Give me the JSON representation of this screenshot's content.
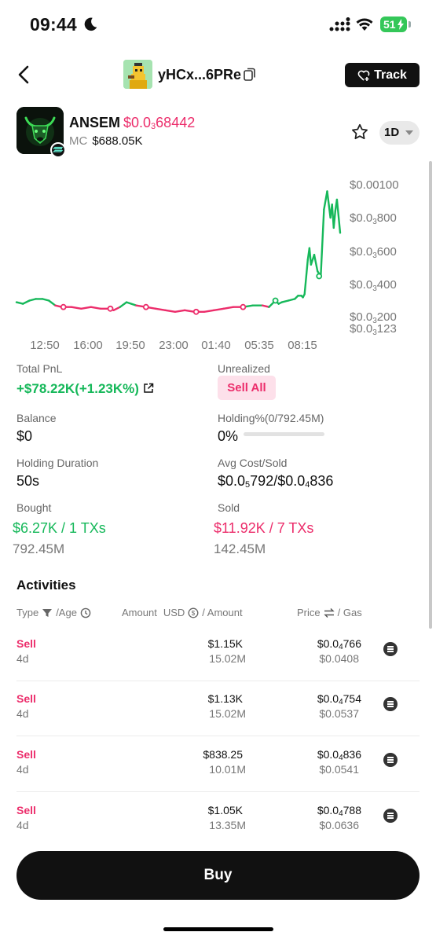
{
  "status": {
    "time": "09:44",
    "battery": "51"
  },
  "header": {
    "wallet_name": "yHCx...6PRe",
    "track_label": "Track"
  },
  "token": {
    "name": "ANSEM",
    "price_prefix": "$0.0",
    "price_sub": "3",
    "price_rest": "68442",
    "mc_label": "MC",
    "mc_value": "$688.05K",
    "timeframe": "1D"
  },
  "icons": {
    "back": "chevron-left-icon",
    "copy": "copy-icon",
    "track": "heart-plus-icon",
    "star": "star-icon",
    "external": "external-link-icon",
    "filter": "filter-icon",
    "clock": "clock-icon",
    "coin": "dollar-coin-icon",
    "swap": "swap-icon",
    "detail": "list-icon"
  },
  "colors": {
    "up": "#16b85a",
    "down": "#ec2d6b",
    "accent_bg": "#111111"
  },
  "chart_data": {
    "type": "line",
    "x_ticks": [
      "12:50",
      "16:00",
      "19:50",
      "23:00",
      "01:40",
      "05:35",
      "08:15"
    ],
    "y_ticks": [
      {
        "prefix": "$0.00100",
        "sub": "",
        "rest": "",
        "value": 0.001
      },
      {
        "prefix": "$0.0",
        "sub": "3",
        "rest": "800",
        "value": 0.0008
      },
      {
        "prefix": "$0.0",
        "sub": "3",
        "rest": "600",
        "value": 0.0006
      },
      {
        "prefix": "$0.0",
        "sub": "3",
        "rest": "400",
        "value": 0.0004
      },
      {
        "prefix": "$0.0",
        "sub": "3",
        "rest": "200",
        "value": 0.0002
      },
      {
        "prefix": "$0.0",
        "sub": "3",
        "rest": "123",
        "value": 0.000123
      }
    ],
    "ylim": [
      0.000123,
      0.001
    ],
    "series": [
      {
        "x": [
          0,
          0.02,
          0.04,
          0.06,
          0.08,
          0.1,
          0.12,
          0.14,
          0.17,
          0.2,
          0.23,
          0.26,
          0.29,
          0.3,
          0.32,
          0.34,
          0.37,
          0.4,
          0.43,
          0.46,
          0.49,
          0.52,
          0.55,
          0.58,
          0.61,
          0.64,
          0.67,
          0.7,
          0.73,
          0.76,
          0.78,
          0.8,
          0.81,
          0.82,
          0.84,
          0.86,
          0.87,
          0.88,
          0.885,
          0.89,
          0.9,
          0.905,
          0.91,
          0.92,
          0.93,
          0.94,
          0.95,
          0.96,
          0.97,
          0.975,
          0.98,
          0.985,
          0.99,
          1.0
        ],
        "y": [
          0.00029,
          0.00028,
          0.0003,
          0.00031,
          0.00031,
          0.0003,
          0.00027,
          0.00026,
          0.00026,
          0.00025,
          0.00026,
          0.00025,
          0.00025,
          0.00024,
          0.00026,
          0.00029,
          0.00027,
          0.00026,
          0.00025,
          0.00024,
          0.00023,
          0.00024,
          0.00023,
          0.00023,
          0.00024,
          0.00025,
          0.00026,
          0.00026,
          0.00027,
          0.00027,
          0.00026,
          0.0003,
          0.00028,
          0.00029,
          0.0003,
          0.00031,
          0.00033,
          0.00033,
          0.00032,
          0.00034,
          0.00055,
          0.00062,
          0.00052,
          0.00058,
          0.00048,
          0.00045,
          0.00085,
          0.00096,
          0.0008,
          0.00088,
          0.00074,
          0.00084,
          0.00091,
          0.00071
        ]
      }
    ],
    "markers": [
      {
        "xi": 0.145,
        "y": 0.00026
      },
      {
        "xi": 0.29,
        "y": 0.00025
      },
      {
        "xi": 0.4,
        "y": 0.00026
      },
      {
        "xi": 0.555,
        "y": 0.00023
      },
      {
        "xi": 0.7,
        "y": 0.00026
      },
      {
        "xi": 0.8,
        "y": 0.0003
      },
      {
        "xi": 0.935,
        "y": 0.00045
      }
    ]
  },
  "stats": {
    "total_pnl_label": "Total PnL",
    "total_pnl_value": "+$78.22K(+1.23K%)",
    "unrealized_label": "Unrealized",
    "sell_all_label": "Sell All",
    "balance_label": "Balance",
    "balance_value": "$0",
    "holding_label": "Holding%(0/792.45M)",
    "holding_value": "0%",
    "holding_fraction": 0,
    "duration_label": "Holding Duration",
    "duration_value": "50s",
    "avg_label": "Avg Cost/Sold",
    "avg_a_prefix": "$0.0",
    "avg_a_sub": "5",
    "avg_a_rest": "792/$0.0",
    "avg_b_sub": "4",
    "avg_b_rest": "836",
    "bought_label": "Bought",
    "bought_value": "$6.27K / 1 TXs",
    "bought_amount": "792.45M",
    "sold_label": "Sold",
    "sold_value": "$11.92K / 7 TXs",
    "sold_amount": "142.45M"
  },
  "activities": {
    "title": "Activities",
    "col_type": "Type",
    "col_age": "/Age",
    "col_amount_a": "Amount",
    "col_amount_usd": "USD",
    "col_amount_b": "/ Amount",
    "col_price": "Price",
    "col_gas": "/ Gas",
    "rows": [
      {
        "type": "Sell",
        "age": "4d",
        "usd": "$1.15K",
        "amount": "15.02M",
        "price_prefix": "$0.0",
        "price_sub": "4",
        "price_rest": "766",
        "gas": "$0.0408"
      },
      {
        "type": "Sell",
        "age": "4d",
        "usd": "$1.13K",
        "amount": "15.02M",
        "price_prefix": "$0.0",
        "price_sub": "4",
        "price_rest": "754",
        "gas": "$0.0537"
      },
      {
        "type": "Sell",
        "age": "4d",
        "usd": "$838.25",
        "amount": "10.01M",
        "price_prefix": "$0.0",
        "price_sub": "4",
        "price_rest": "836",
        "gas": "$0.0541"
      },
      {
        "type": "Sell",
        "age": "4d",
        "usd": "$1.05K",
        "amount": "13.35M",
        "price_prefix": "$0.0",
        "price_sub": "4",
        "price_rest": "788",
        "gas": "$0.0636"
      }
    ]
  },
  "buy_label": "Buy"
}
